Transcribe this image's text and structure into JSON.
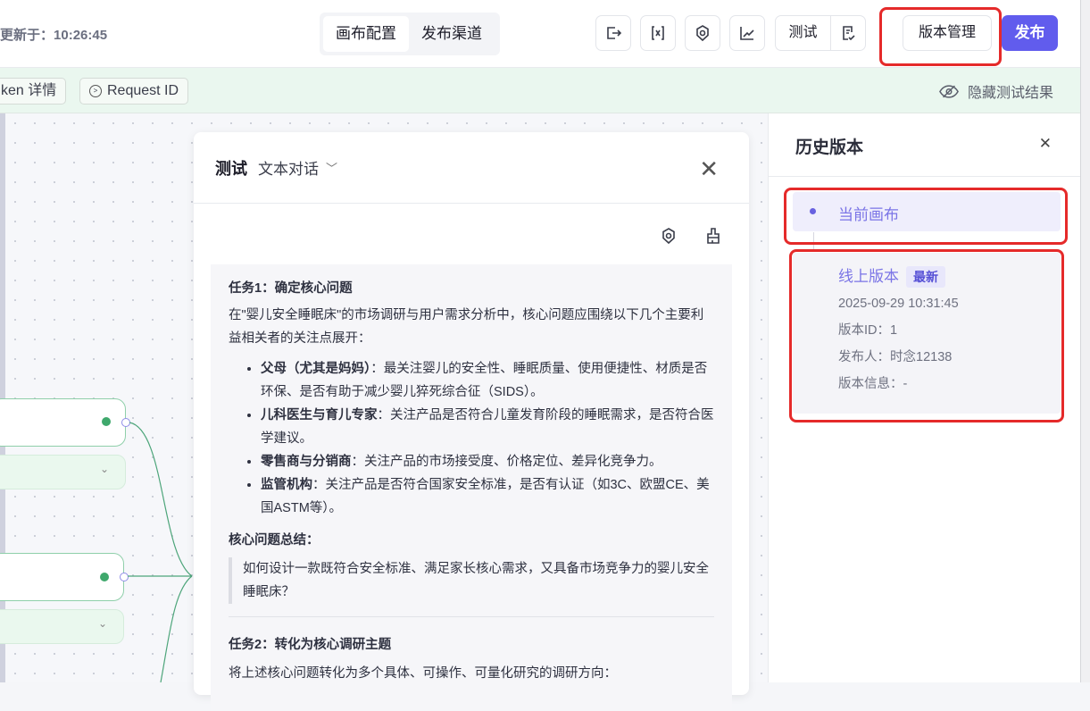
{
  "topbar": {
    "updated_label": "更新于：",
    "updated_time": "10:26:45",
    "tabs": [
      {
        "label": "画布配置",
        "active": true
      },
      {
        "label": "发布渠道",
        "active": false
      }
    ],
    "test_label": "测试",
    "version_mgmt_label": "版本管理",
    "publish_label": "发布"
  },
  "testbar": {
    "token_label": "ken 详情",
    "request_id_label": "Request ID",
    "hide_label": "隐藏测试结果"
  },
  "test_panel": {
    "title": "测试",
    "mode": "文本对话",
    "task1_title": "任务1：确定核心问题",
    "task1_intro": "在\"婴儿安全睡眠床\"的市场调研与用户需求分析中，核心问题应围绕以下几个主要利益相关者的关注点展开：",
    "stakeholders": [
      {
        "name": "父母（尤其是妈妈）",
        "text": "：最关注婴儿的安全性、睡眠质量、使用便捷性、材质是否环保、是否有助于减少婴儿猝死综合征（SIDS）。"
      },
      {
        "name": "儿科医生与育儿专家",
        "text": "：关注产品是否符合儿童发育阶段的睡眠需求，是否符合医学建议。"
      },
      {
        "name": "零售商与分销商",
        "text": "：关注产品的市场接受度、价格定位、差异化竞争力。"
      },
      {
        "name": "监管机构",
        "text": "：关注产品是否符合国家安全标准，是否有认证（如3C、欧盟CE、美国ASTM等）。"
      }
    ],
    "summary_title": "核心问题总结：",
    "summary_quote": "如何设计一款既符合安全标准、满足家长核心需求，又具备市场竞争力的婴儿安全睡眠床？",
    "task2_title": "任务2：转化为核心调研主题",
    "task2_intro": "将上述核心问题转化为多个具体、可操作、可量化研究的调研方向："
  },
  "version_panel": {
    "title": "历史版本",
    "current_label": "当前画布",
    "online": {
      "name": "线上版本",
      "tag": "最新",
      "datetime": "2025-09-29 10:31:45",
      "version_id": "版本ID：1",
      "publisher": "发布人：时念12138",
      "info": "版本信息：-"
    }
  },
  "colors": {
    "accent": "#615ced",
    "highlight": "#e52a2a",
    "test_bar_bg": "#eaf7ef"
  }
}
